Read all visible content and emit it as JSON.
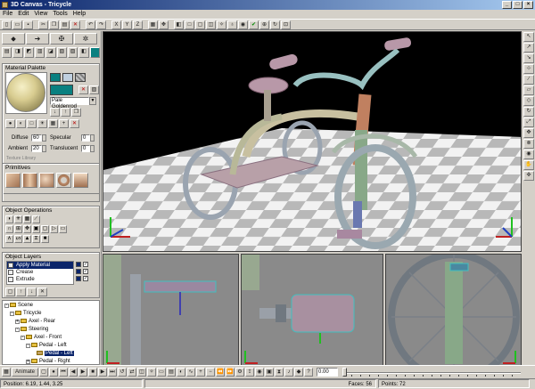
{
  "window": {
    "title": "3D Canvas - Tricycle",
    "min": "_",
    "max": "□",
    "close": "×"
  },
  "menu": [
    "File",
    "Edit",
    "View",
    "Tools",
    "Help"
  ],
  "toolbar": {
    "axis_x": "X",
    "axis_y": "Y",
    "axis_z": "Z"
  },
  "material_palette": {
    "title": "Material Palette",
    "selected_material": "Pale Goldenrod",
    "diffuse_label": "Diffuse",
    "diffuse_value": "60",
    "ambient_label": "Ambient",
    "ambient_value": "20",
    "specular_label": "Specular",
    "specular_value": "0",
    "translucent_label": "Translucent",
    "translucent_value": "0",
    "texture_label": "Texture Library",
    "colors": {
      "swatch1": "#0a8080",
      "swatch2": "#c0d0e0",
      "swatch3": "#808080"
    }
  },
  "primitives": {
    "title": "Primitives"
  },
  "object_operations": {
    "title": "Object Operations"
  },
  "object_layers": {
    "title": "Object Layers",
    "layers": [
      "Apply Material",
      "Crease",
      "Extrude"
    ]
  },
  "scene_tree": {
    "items": [
      {
        "label": "Scene",
        "level": 0
      },
      {
        "label": "Tricycle",
        "level": 1
      },
      {
        "label": "Axel - Rear",
        "level": 2
      },
      {
        "label": "Steering",
        "level": 2
      },
      {
        "label": "Axel - Front",
        "level": 3
      },
      {
        "label": "Pedal - Left",
        "level": 4
      },
      {
        "label": "Pedal - Left",
        "level": 5,
        "selected": true
      },
      {
        "label": "Pedal - Right",
        "level": 4
      }
    ]
  },
  "animation": {
    "button": "Animate",
    "frame": "0.00"
  },
  "status": {
    "position": "Position: 6.19, 1.44, 3.25",
    "faces": "Faces: 56",
    "points": "Points: 72"
  }
}
